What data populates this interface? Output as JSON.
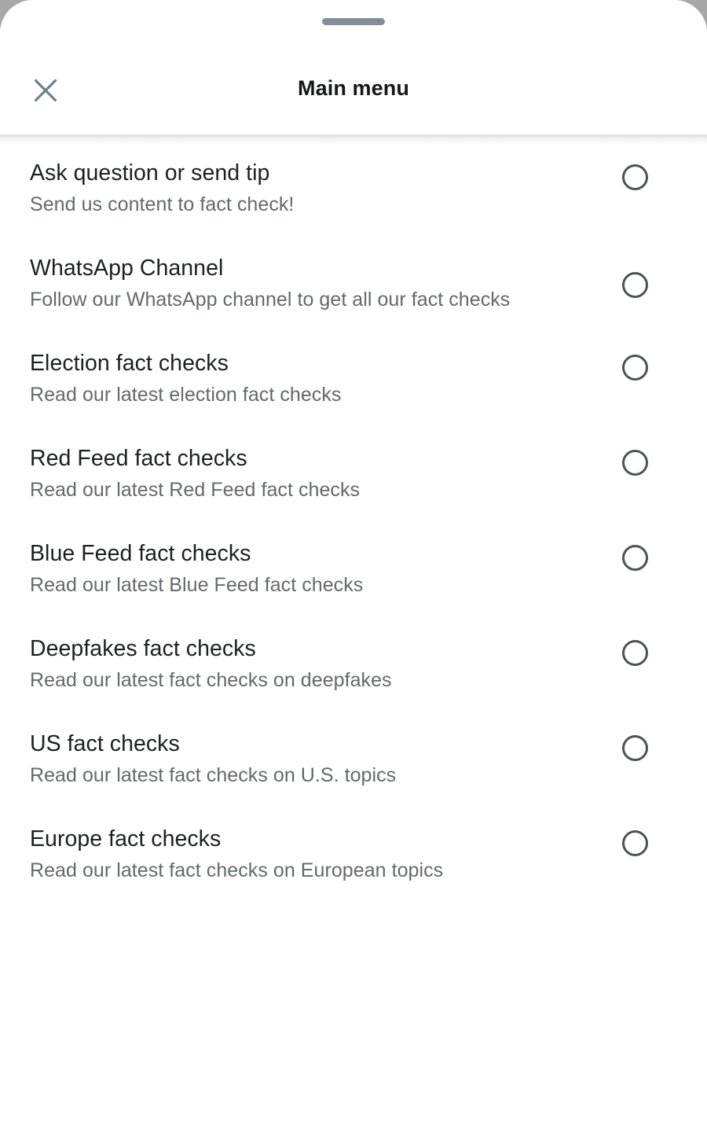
{
  "sheet": {
    "drag_handle": "drag-handle",
    "background_color": "#ffffff",
    "page_background_color": "#a8a8a8"
  },
  "header": {
    "title": "Main menu",
    "close_label": "Close",
    "close_icon": "close-icon",
    "title_color": "#14181c",
    "close_icon_color": "#70818a"
  },
  "menu": {
    "items": [
      {
        "title": "Ask question or send tip",
        "subtitle": "Send us content to fact check!",
        "selected": false
      },
      {
        "title": "WhatsApp Channel",
        "subtitle": "Follow our WhatsApp channel to get all our fact checks",
        "selected": false
      },
      {
        "title": "Election fact checks",
        "subtitle": "Read our latest election fact checks",
        "selected": false
      },
      {
        "title": "Red Feed fact checks",
        "subtitle": "Read our latest Red Feed fact checks",
        "selected": false
      },
      {
        "title": "Blue Feed fact checks",
        "subtitle": "Read our latest Blue Feed fact checks",
        "selected": false
      },
      {
        "title": "Deepfakes fact checks",
        "subtitle": "Read our latest fact checks on deepfakes",
        "selected": false
      },
      {
        "title": "US fact checks",
        "subtitle": "Read our latest fact checks on U.S. topics",
        "selected": false
      },
      {
        "title": "Europe fact checks",
        "subtitle": "Read our latest fact checks on European topics",
        "selected": false
      }
    ],
    "radio_icon": "radio-unselected-icon",
    "radio_color": "#4e5256",
    "title_color": "#1d1f21",
    "subtitle_color": "#64696e"
  }
}
